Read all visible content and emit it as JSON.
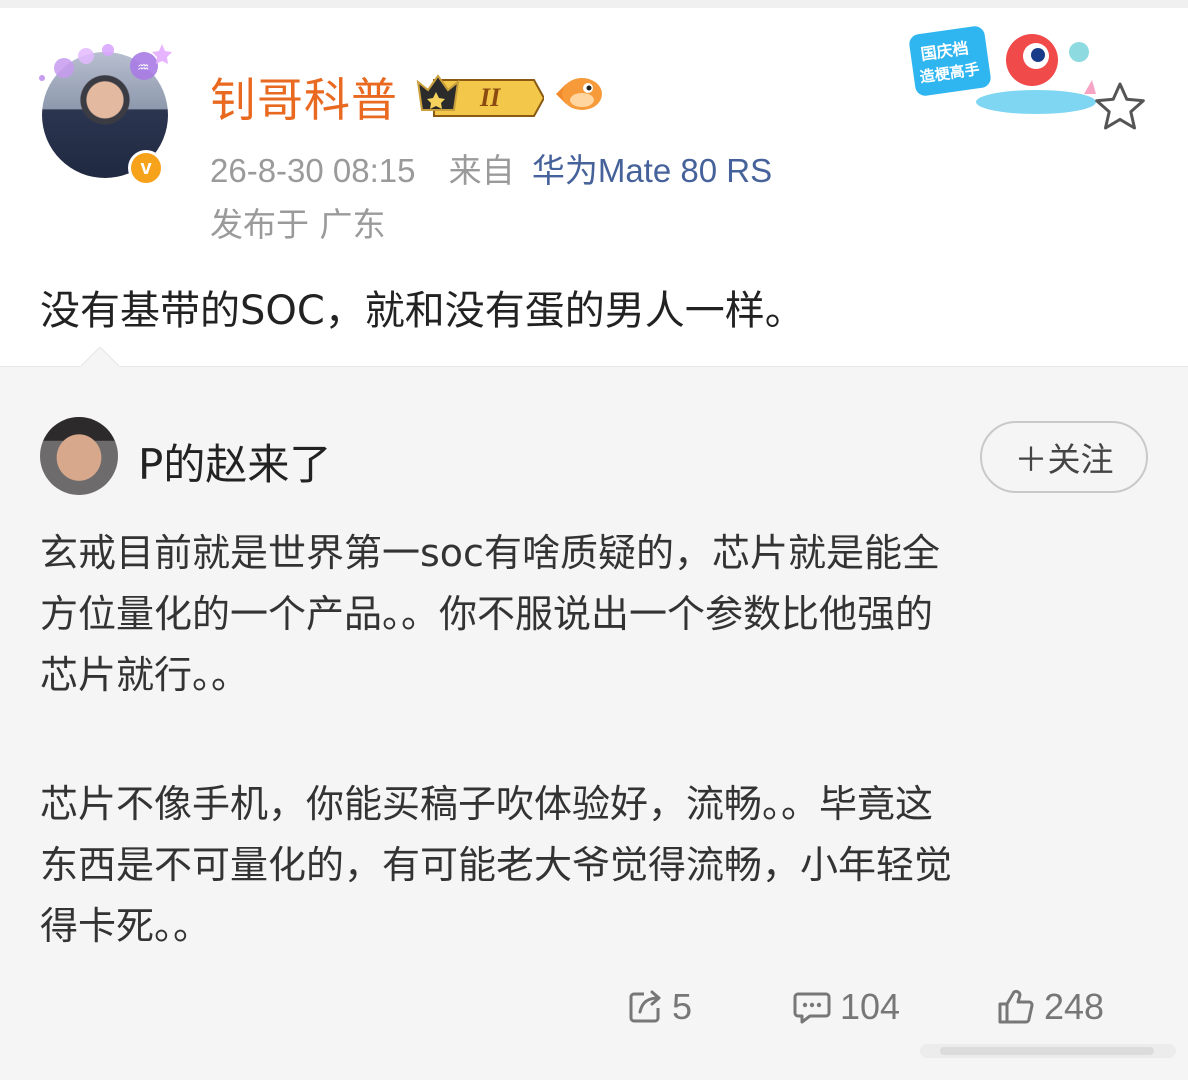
{
  "post": {
    "author": "钊哥科普",
    "level_badge": "II",
    "timestamp": "26-8-30 08:15",
    "source_prefix": "来自",
    "device": "华为Mate 80 RS",
    "location": "发布于 广东",
    "text": "没有基带的SOC，就和没有蛋的男人一样。",
    "sticker_text": [
      "国庆档",
      "造梗高手"
    ]
  },
  "repost": {
    "author": "P的赵来了",
    "follow_label": "＋关注",
    "paragraph1": "玄戒目前就是世界第一soc有啥质疑的，芯片就是能全\n方位量化的一个产品。。你不服说出一个参数比他强的\n芯片就行。。",
    "paragraph2": "芯片不像手机，你能买稿子吹体验好，流畅。。毕竟这\n东西是不可量化的，有可能老大爷觉得流畅，小年轻觉\n得卡死。。",
    "reposts": "5",
    "comments": "104",
    "likes": "248"
  },
  "colors": {
    "username_orange": "#e8691f",
    "device_blue": "#46629a",
    "meta_gray": "#9a9a9a",
    "card_bg": "#f5f5f5",
    "verified_badge": "#f7a21b"
  },
  "icons": [
    "verified-v-icon",
    "crown-level-icon",
    "fish-badge-icon",
    "star-favorite-icon",
    "repost-icon",
    "comment-icon",
    "like-icon"
  ]
}
